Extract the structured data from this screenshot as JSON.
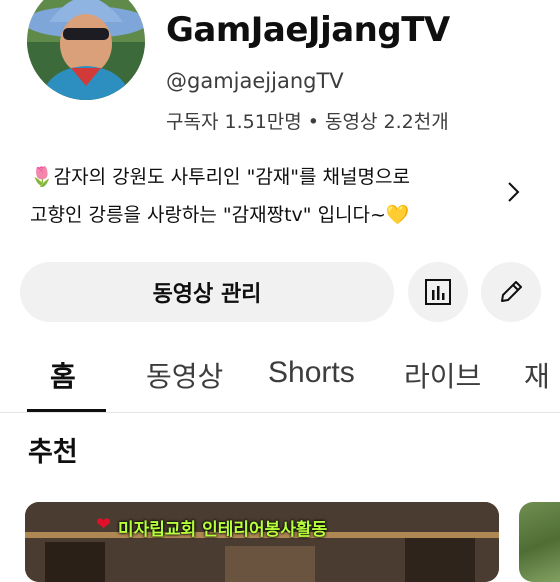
{
  "channel": {
    "name": "GamJaeJjangTV",
    "handle": "@gamjaejjangTV",
    "stats": "구독자 1.51만명 • 동영상 2.2천개",
    "description_line1": "🌷감자의 강원도 사투리인 \"감재\"를 채널명으로",
    "description_line2": "고향인 강릉을 사랑하는 \"감재짱tv\" 입니다~💛"
  },
  "actions": {
    "manage_videos_label": "동영상 관리",
    "analytics_icon": "analytics-icon",
    "edit_icon": "pencil-icon"
  },
  "tabs": [
    {
      "label": "홈",
      "selected": true
    },
    {
      "label": "동영상",
      "selected": false
    },
    {
      "label": "Shorts",
      "selected": false
    },
    {
      "label": "라이브",
      "selected": false
    },
    {
      "label": "재",
      "selected": false
    }
  ],
  "section": {
    "title": "추천"
  },
  "videos": [
    {
      "thumbnail_caption": "미자립교회 인테리어봉사활동",
      "caption_emoji": "❤"
    }
  ],
  "colors": {
    "text_primary": "#0f0f0f",
    "text_secondary": "#3d3d3d",
    "button_bg": "#f1f1f1",
    "caption_green": "#b7ff3a"
  }
}
